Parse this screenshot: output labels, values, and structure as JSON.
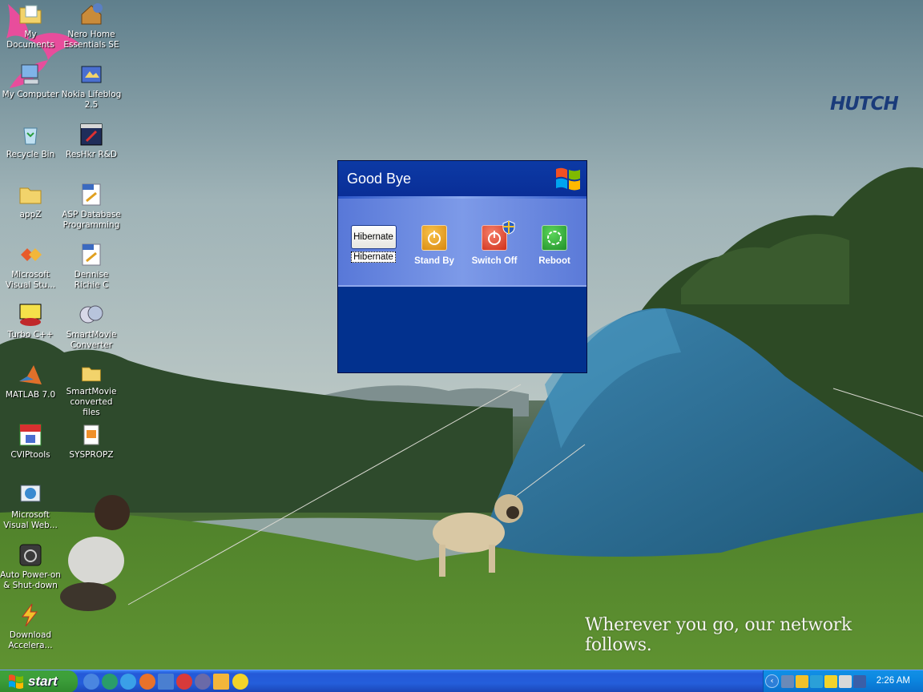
{
  "wallpaper": {
    "brand": "HUTCH",
    "tagline": "Wherever you go, our network follows."
  },
  "desktop_icons": [
    {
      "label": "My Documents",
      "icon": "folder-documents-icon"
    },
    {
      "label": "Nero Home Essentials SE",
      "icon": "nero-home-icon"
    },
    {
      "label": "My Computer",
      "icon": "computer-icon"
    },
    {
      "label": "Nokia Lifeblog 2.5",
      "icon": "lifeblog-icon"
    },
    {
      "label": "Recycle Bin",
      "icon": "recycle-bin-icon"
    },
    {
      "label": "ResHkr R&D",
      "icon": "reshacker-icon"
    },
    {
      "label": "appZ",
      "icon": "folder-icon"
    },
    {
      "label": "ASP Database Programming",
      "icon": "pdf-icon"
    },
    {
      "label": "Microsoft Visual Stu...",
      "icon": "visual-studio-icon"
    },
    {
      "label": "Dennise Richie C",
      "icon": "pdf-icon"
    },
    {
      "label": "Turbo C++",
      "icon": "turbo-cpp-icon"
    },
    {
      "label": "SmartMovie Converter",
      "icon": "smartmovie-icon"
    },
    {
      "label": "MATLAB 7.0",
      "icon": "matlab-icon"
    },
    {
      "label": "SmartMovie converted files",
      "icon": "folder-icon"
    },
    {
      "label": "CVIPtools",
      "icon": "cviptools-icon"
    },
    {
      "label": "SYSPROPZ",
      "icon": "sysprop-icon"
    },
    {
      "label": "Microsoft Visual Web...",
      "icon": "visual-web-icon"
    },
    {
      "label": "Auto Power-on & Shut-down",
      "icon": "auto-power-icon"
    },
    {
      "label": "Download Accelera...",
      "icon": "download-accelerator-icon"
    }
  ],
  "dialog": {
    "title": "Good Bye",
    "options": [
      {
        "label": "Hibernate",
        "button_text": "Hibernate",
        "icon": "hibernate-button"
      },
      {
        "label": "Stand By",
        "icon": "standby-icon"
      },
      {
        "label": "Switch Off",
        "icon": "power-off-icon"
      },
      {
        "label": "Reboot",
        "icon": "restart-icon"
      }
    ]
  },
  "taskbar": {
    "start_label": "start",
    "quick_launch": [
      "ie-icon",
      "network-icon",
      "internet-explorer-icon",
      "firefox-icon",
      "triangle-app-icon",
      "opera-icon",
      "media-player-icon",
      "notepad-icon",
      "messenger-icon"
    ],
    "tray_icons": [
      "network-icon",
      "security-shield-icon",
      "wireless-icon",
      "warning-icon",
      "volume-icon",
      "battery-icon"
    ],
    "clock": "2:26 AM"
  },
  "colors": {
    "dialog_bg": "#02318e",
    "dialog_panel": "#7d9ae8",
    "taskbar": "#245edb",
    "start_button": "#3c9e3a",
    "tray": "#0c87e0",
    "brand_pink": "#e84d9c",
    "brand_blue": "#1a3b7a"
  }
}
